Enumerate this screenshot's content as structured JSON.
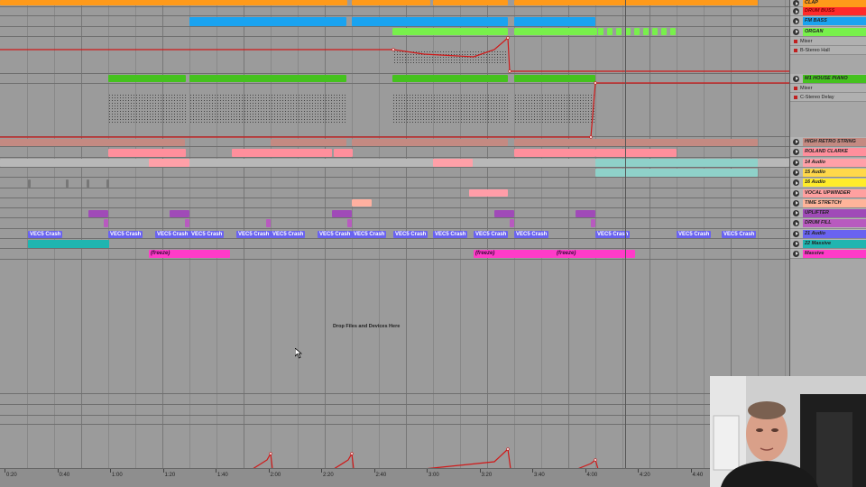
{
  "tracks": [
    {
      "name": "CLAP",
      "color": "#ff9a1a"
    },
    {
      "name": "DRUM BUSS",
      "color": "#ff2a2a"
    },
    {
      "name": "FM BASS",
      "color": "#1aa3f0"
    },
    {
      "name": "ORGAN",
      "color": "#78f04b"
    },
    {
      "name": "M1 HOUSE PIANO",
      "color": "#45c21e"
    },
    {
      "name": "HIGH RETRO STRING",
      "color": "#c48a82"
    },
    {
      "name": "ROLAND CLARKE",
      "color": "#ff8f9c"
    },
    {
      "name": "14 Audio",
      "color": "#ffa0a8"
    },
    {
      "name": "15 Audio",
      "color": "#ffd84a"
    },
    {
      "name": "16 Audio",
      "color": "#ffec2a"
    },
    {
      "name": "VOCAL UPWINDER",
      "color": "#ffa0a0"
    },
    {
      "name": "TIME STRETCH",
      "color": "#ffb49a"
    },
    {
      "name": "UPLIFTER",
      "color": "#a04ab8"
    },
    {
      "name": "DRUM FILL",
      "color": "#b85abf"
    },
    {
      "name": "21 Audio",
      "color": "#6a63f0"
    },
    {
      "name": "22 Massive",
      "color": "#1fb5b0"
    },
    {
      "name": "Massive",
      "color": "#ff3bc8"
    }
  ],
  "subrows": {
    "organ_mixer": "Mixer",
    "organ_device": "B-Stereo Hall",
    "piano_mixer": "Mixer",
    "piano_device": "C-Stereo Delay"
  },
  "clip_labels": {
    "vec": "VEC5 Crash 0",
    "freeze": "(freeze)"
  },
  "drop_hint": "Drop Files and Devices Here",
  "timeline": [
    "0:20",
    "0:40",
    "1:00",
    "1:20",
    "1:40",
    "2:00",
    "2:20",
    "2:40",
    "3:00",
    "3:20",
    "3:40",
    "4:00",
    "4:20",
    "4:40"
  ]
}
